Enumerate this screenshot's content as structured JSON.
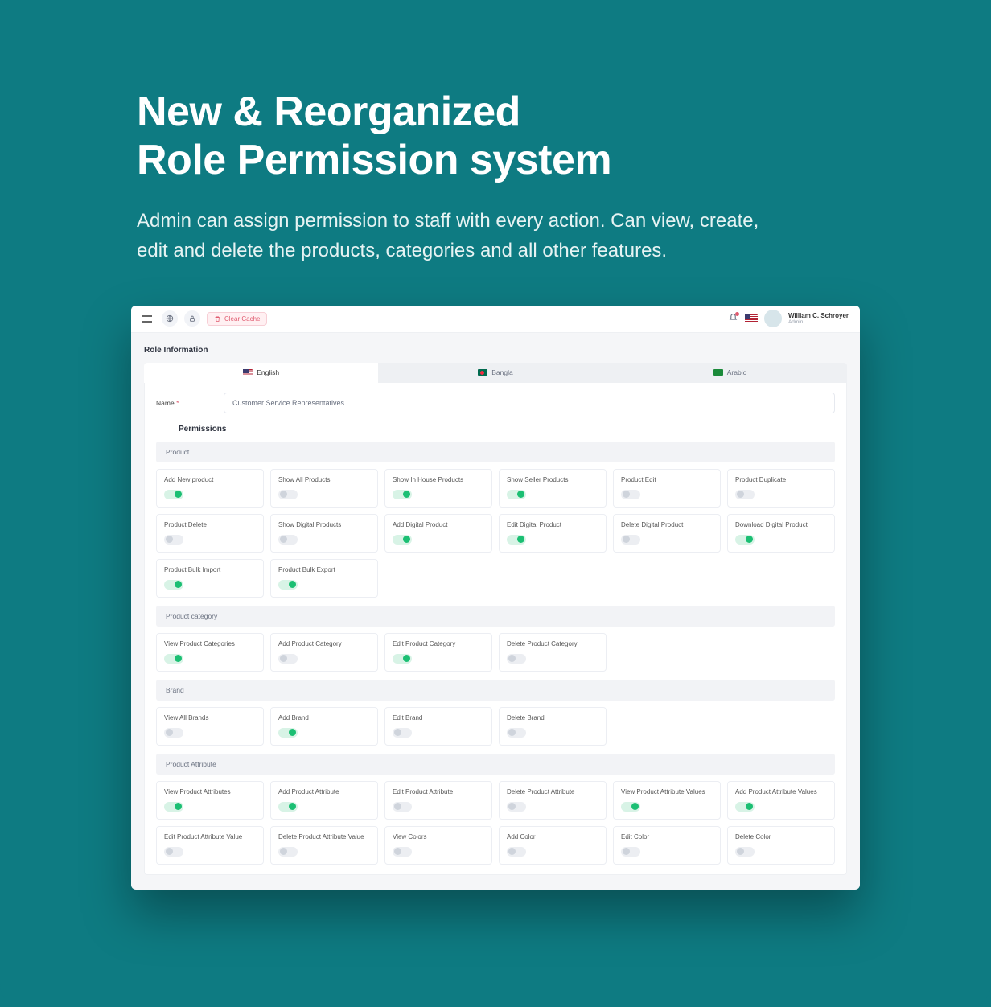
{
  "hero": {
    "title_line1": "New & Reorganized",
    "title_line2": "Role Permission system",
    "subtitle": "Admin can assign permission to staff with every action. Can view, create, edit and delete the products, categories and all other features."
  },
  "topbar": {
    "clear_cache": "Clear Cache",
    "user_name": "William C. Schroyer",
    "user_role": "Admin"
  },
  "role_info_title": "Role Information",
  "lang_tabs": {
    "english": "English",
    "bangla": "Bangla",
    "arabic": "Arabic"
  },
  "name_label": "Name",
  "name_value": "Customer Service Representatives",
  "permissions_title": "Permissions",
  "groups": [
    {
      "title": "Product",
      "items": [
        {
          "label": "Add New product",
          "on": true
        },
        {
          "label": "Show All Products",
          "on": false
        },
        {
          "label": "Show In House Products",
          "on": true
        },
        {
          "label": "Show Seller Products",
          "on": true
        },
        {
          "label": "Product Edit",
          "on": false
        },
        {
          "label": "Product Duplicate",
          "on": false
        },
        {
          "label": "Product Delete",
          "on": false
        },
        {
          "label": "Show Digital Products",
          "on": false
        },
        {
          "label": "Add Digital Product",
          "on": true
        },
        {
          "label": "Edit Digital Product",
          "on": true
        },
        {
          "label": "Delete Digital Product",
          "on": false
        },
        {
          "label": "Download Digital Product",
          "on": true
        },
        {
          "label": "Product Bulk Import",
          "on": true
        },
        {
          "label": "Product Bulk Export",
          "on": true
        }
      ]
    },
    {
      "title": "Product category",
      "items": [
        {
          "label": "View Product Categories",
          "on": true
        },
        {
          "label": "Add Product Category",
          "on": false
        },
        {
          "label": "Edit Product Category",
          "on": true
        },
        {
          "label": "Delete Product Category",
          "on": false
        }
      ]
    },
    {
      "title": "Brand",
      "items": [
        {
          "label": "View All Brands",
          "on": false
        },
        {
          "label": "Add Brand",
          "on": true
        },
        {
          "label": "Edit Brand",
          "on": false
        },
        {
          "label": "Delete Brand",
          "on": false
        }
      ]
    },
    {
      "title": "Product Attribute",
      "items": [
        {
          "label": "View Product Attributes",
          "on": true
        },
        {
          "label": "Add Product Attribute",
          "on": true
        },
        {
          "label": "Edit Product Attribute",
          "on": false
        },
        {
          "label": "Delete Product Attribute",
          "on": false
        },
        {
          "label": "View Product Attribute Values",
          "on": true
        },
        {
          "label": "Add Product Attribute Values",
          "on": true
        },
        {
          "label": "Edit Product Attribute Value",
          "on": false
        },
        {
          "label": "Delete Product Attribute Value",
          "on": false
        },
        {
          "label": "View Colors",
          "on": false
        },
        {
          "label": "Add Color",
          "on": false
        },
        {
          "label": "Edit Color",
          "on": false
        },
        {
          "label": "Delete Color",
          "on": false
        }
      ]
    }
  ]
}
